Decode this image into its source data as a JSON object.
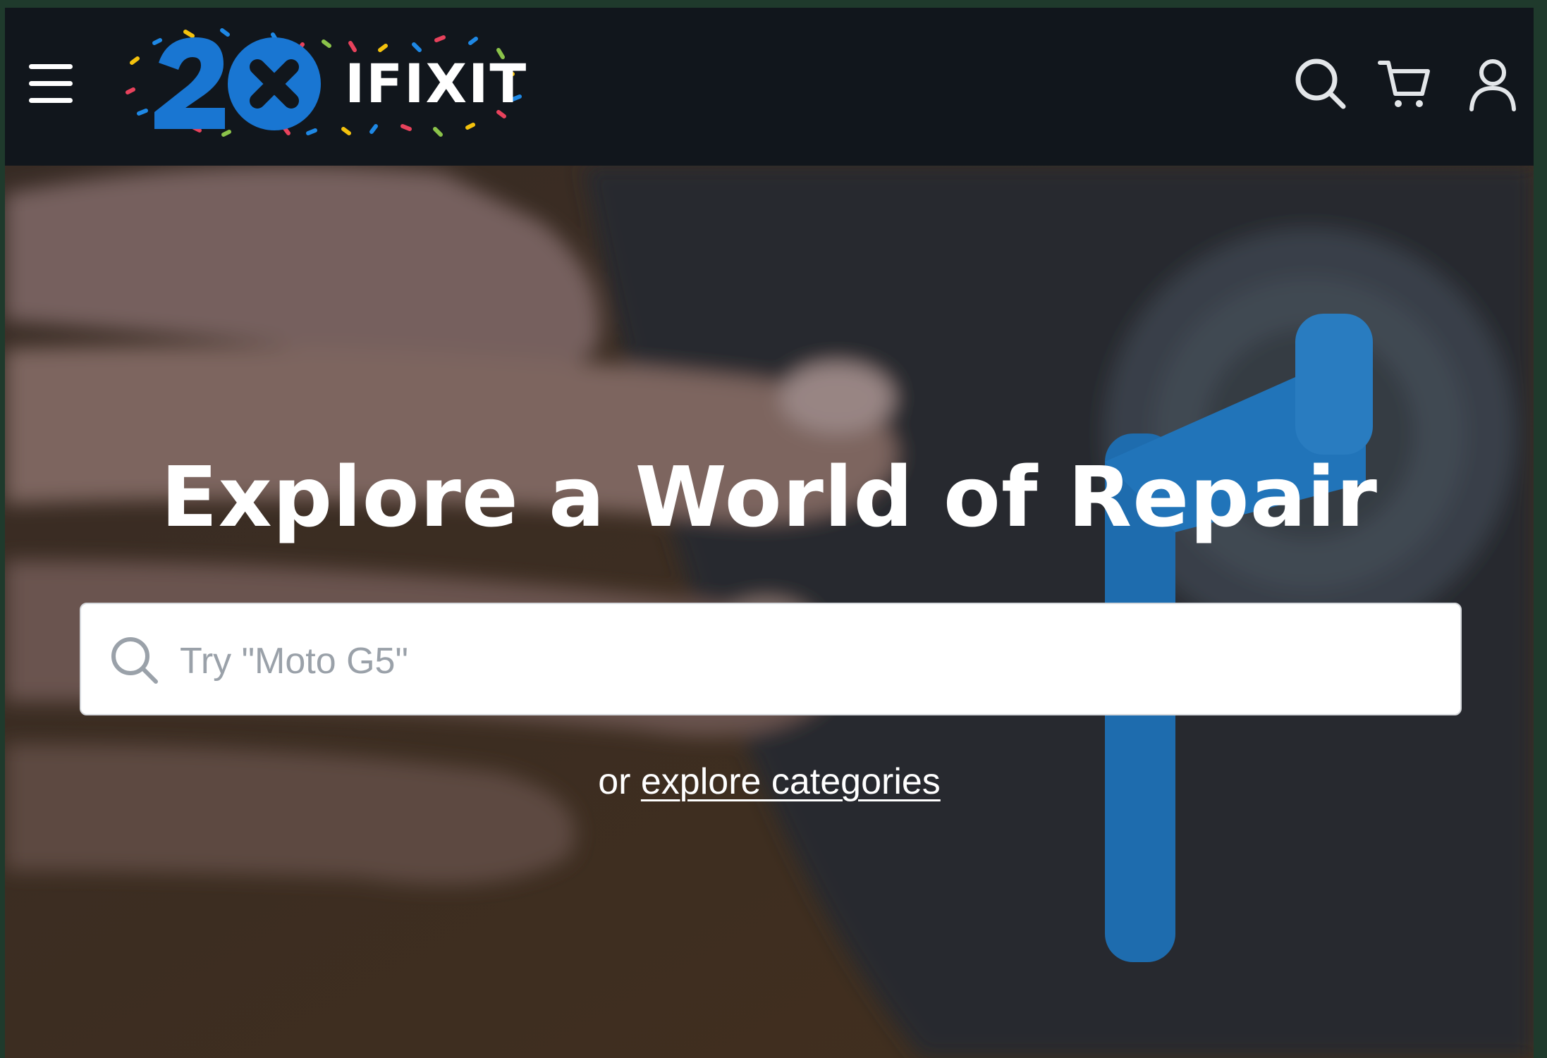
{
  "header": {
    "logo_text": "IFIXIT",
    "logo_badge": "20",
    "icons": [
      "menu-icon",
      "search-icon",
      "cart-icon",
      "user-icon"
    ]
  },
  "hero": {
    "title": "Explore a World of Repair",
    "search": {
      "placeholder": "Try \"Moto G5\"",
      "value": ""
    },
    "explore_prefix": "or",
    "explore_link": "explore categories"
  },
  "colors": {
    "header_bg": "#11161c",
    "brand_blue": "#1976d2",
    "search_placeholder": "#9aa1a9"
  }
}
